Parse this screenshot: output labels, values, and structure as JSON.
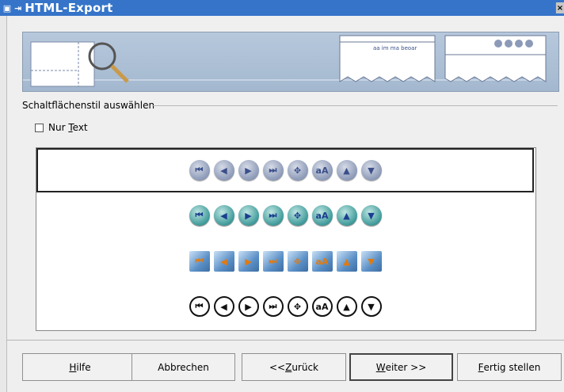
{
  "window": {
    "title": "HTML-Export"
  },
  "section": {
    "title": "Schaltflächenstil auswählen"
  },
  "option": {
    "prefix": "Nur ",
    "accel": "T",
    "suffix": "ext"
  },
  "banner": {
    "card_text": "aa im ma beoar"
  },
  "icons": [
    "first",
    "previous",
    "next",
    "last",
    "navigator",
    "text",
    "up",
    "down"
  ],
  "glyphs": [
    "⏮",
    "◀",
    "▶",
    "⏭",
    "✥",
    "aA",
    "▲",
    "▼"
  ],
  "buttons": {
    "help": {
      "accel": "H",
      "rest": "ilfe"
    },
    "cancel": {
      "label": "Abbrechen"
    },
    "back": {
      "pre": "<< ",
      "accel": "Z",
      "rest": "urück"
    },
    "next": {
      "accel": "W",
      "rest": "eiter >>"
    },
    "finish": {
      "accel": "F",
      "rest": "ertig stellen"
    }
  },
  "colors": {
    "titlebar": "#3574c9",
    "dialog_bg": "#efefef",
    "banner": "#a3b8cf"
  }
}
